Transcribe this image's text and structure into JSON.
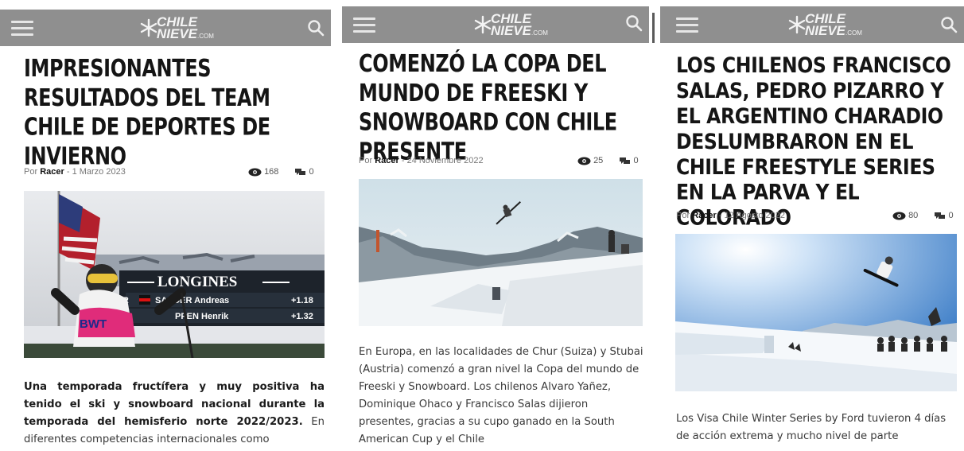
{
  "brand": {
    "logo_line1": "CHILE",
    "logo_line2": "NIEVE",
    "logo_suffix": ".COM"
  },
  "articles": [
    {
      "title": "IMPRESIONANTES RESULTADOS DEL TEAM CHILE DE DEPORTES DE INVIERNO",
      "by": "Por",
      "author": "Racer",
      "date": "1 Marzo 2023",
      "views": "168",
      "comments": "0",
      "photo_text": {
        "banner": "LONGINES",
        "row1_name": "SANDER Andreas",
        "row1_prefix": "GER",
        "row1_time": "+1.18",
        "row2_name": "PPEN Henrik",
        "row2_time": "+1.32",
        "bib_text": "BWT"
      },
      "body_bold": "Una temporada fructífera y muy positiva ha tenido el ski y snowboard nacional durante la temporada del hemisferio norte 2022/2023.",
      "body_rest": " En diferentes competencias internacionales como"
    },
    {
      "title": "COMENZÓ LA COPA DEL MUNDO DE FREESKI Y SNOWBOARD CON CHILE PRESENTE",
      "by": "Por",
      "author": "Racer",
      "date": "24 Noviembre 2022",
      "views": "25",
      "comments": "0",
      "body": "En Europa, en las localidades de Chur (Suiza) y Stubai (Austria) comenzó a gran nivel la Copa del mundo de Freeski y Snowboard. Los chilenos Alvaro Yañez, Dominique Ohaco y Francisco Salas dijieron presentes, gracias a su cupo ganado en la South American Cup y el Chile"
    },
    {
      "title": "LOS CHILENOS FRANCISCO SALAS, PEDRO PIZARRO Y EL ARGENTINO CHARADIO DESLUMBRARON EN EL CHILE FREESTYLE SERIES EN LA PARVA Y EL COLORADO",
      "by": "Por",
      "author": "Racer",
      "date": "12 Agosto 2022",
      "views": "80",
      "comments": "0",
      "body": "Los Visa Chile Winter Series by Ford tuvieron 4 días de acción extrema y mucho nivel de parte"
    }
  ],
  "colors": {
    "header": "#8f8f8f",
    "title": "#151515",
    "meta": "#777777"
  }
}
